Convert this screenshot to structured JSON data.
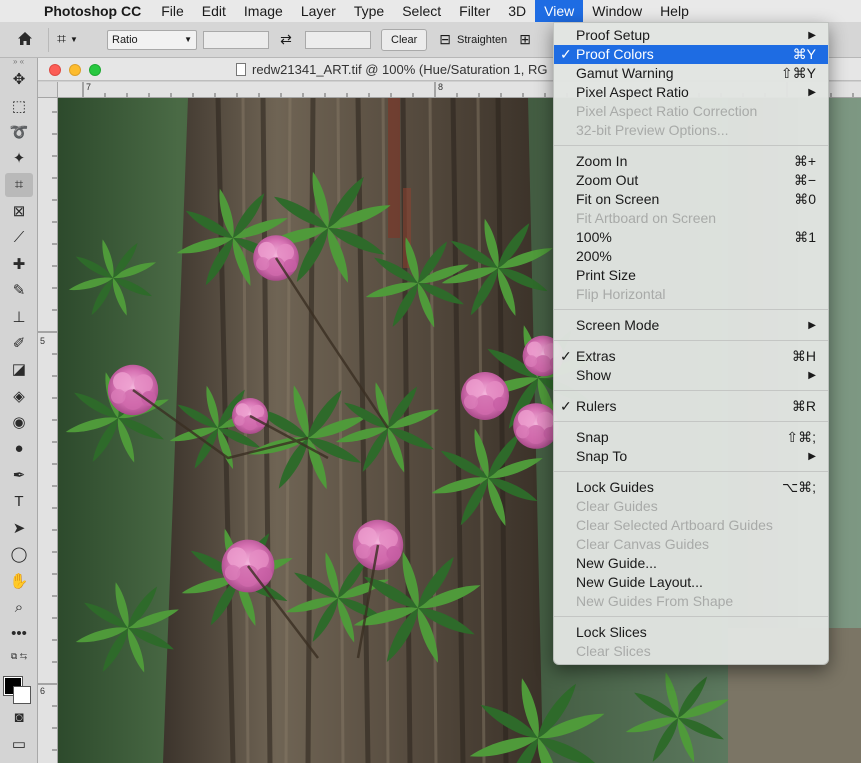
{
  "menubar": {
    "app_name": "Photoshop CC",
    "items": [
      "File",
      "Edit",
      "Image",
      "Layer",
      "Type",
      "Select",
      "Filter",
      "3D",
      "View",
      "Window",
      "Help"
    ],
    "active": "View"
  },
  "options_bar": {
    "ratio_label": "Ratio",
    "clear_label": "Clear",
    "straighten_label": "Straighten"
  },
  "document": {
    "title": "redw21341_ART.tif @ 100% (Hue/Saturation 1, RG",
    "ruler_h_labels": [
      "7",
      "8"
    ],
    "ruler_v_labels": [
      "5",
      "6"
    ]
  },
  "colors": {
    "menu_highlight": "#1e6ce3",
    "foreground": "#000000",
    "background": "#ffffff"
  },
  "view_menu": {
    "groups": [
      [
        {
          "label": "Proof Setup",
          "submenu": true
        },
        {
          "label": "Proof Colors",
          "checked": true,
          "shortcut": "⌘Y",
          "highlight": true
        },
        {
          "label": "Gamut Warning",
          "shortcut": "⇧⌘Y"
        },
        {
          "label": "Pixel Aspect Ratio",
          "submenu": true
        },
        {
          "label": "Pixel Aspect Ratio Correction",
          "disabled": true
        },
        {
          "label": "32-bit Preview Options...",
          "disabled": true
        }
      ],
      [
        {
          "label": "Zoom In",
          "shortcut": "⌘+"
        },
        {
          "label": "Zoom Out",
          "shortcut": "⌘−"
        },
        {
          "label": "Fit on Screen",
          "shortcut": "⌘0"
        },
        {
          "label": "Fit Artboard on Screen",
          "disabled": true
        },
        {
          "label": "100%",
          "shortcut": "⌘1"
        },
        {
          "label": "200%"
        },
        {
          "label": "Print Size"
        },
        {
          "label": "Flip Horizontal",
          "disabled": true
        }
      ],
      [
        {
          "label": "Screen Mode",
          "submenu": true
        }
      ],
      [
        {
          "label": "Extras",
          "checked": true,
          "shortcut": "⌘H"
        },
        {
          "label": "Show",
          "submenu": true
        }
      ],
      [
        {
          "label": "Rulers",
          "checked": true,
          "shortcut": "⌘R"
        }
      ],
      [
        {
          "label": "Snap",
          "shortcut": "⇧⌘;"
        },
        {
          "label": "Snap To",
          "submenu": true
        }
      ],
      [
        {
          "label": "Lock Guides",
          "shortcut": "⌥⌘;"
        },
        {
          "label": "Clear Guides",
          "disabled": true
        },
        {
          "label": "Clear Selected Artboard Guides",
          "disabled": true
        },
        {
          "label": "Clear Canvas Guides",
          "disabled": true
        },
        {
          "label": "New Guide..."
        },
        {
          "label": "New Guide Layout..."
        },
        {
          "label": "New Guides From Shape",
          "disabled": true
        }
      ],
      [
        {
          "label": "Lock Slices"
        },
        {
          "label": "Clear Slices",
          "disabled": true
        }
      ]
    ]
  },
  "tools": [
    "move-tool",
    "marquee-tool",
    "lasso-tool",
    "magic-wand-tool",
    "crop-tool",
    "frame-tool",
    "eyedropper-tool",
    "healing-brush-tool",
    "brush-tool",
    "clone-stamp-tool",
    "history-brush-tool",
    "eraser-tool",
    "paint-bucket-tool",
    "blur-tool",
    "dodge-tool",
    "pen-tool",
    "type-tool",
    "path-selection-tool",
    "ellipse-tool",
    "hand-tool",
    "zoom-tool",
    "more-tools"
  ],
  "tool_glyphs": [
    "✥",
    "⬚",
    "➰",
    "✦",
    "⌗",
    "⊠",
    "⟋",
    "✚",
    "✎",
    "⊥",
    "✐",
    "◪",
    "◈",
    "◉",
    "●",
    "✒",
    "T",
    "➤",
    "◯",
    "✋",
    "⌕",
    "•••"
  ],
  "active_tool": "crop-tool",
  "icons": {
    "apple": "",
    "home": "⌂",
    "crop": "⌗",
    "swap": "⇄",
    "straighten": "⊟",
    "grid": "⊞",
    "checkmark": "✓",
    "submenu": "▶"
  }
}
